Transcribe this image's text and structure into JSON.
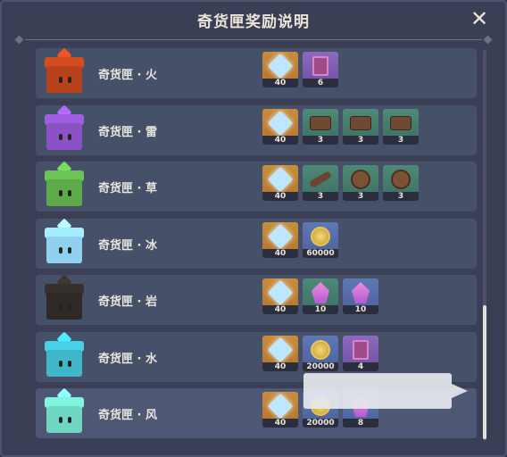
{
  "header": {
    "title": "奇货匣奖励说明",
    "close_icon": "close-icon"
  },
  "colors": {
    "panel_bg": "#3b3f55",
    "row_bg": "#475069",
    "text": "#ece5d8"
  },
  "rows": [
    {
      "name": "奇货匣 · 火",
      "box_color": "#b8421c",
      "rewards": [
        {
          "icon": "primogem-icon",
          "qty": "40",
          "rarity": "orange"
        },
        {
          "icon": "book-icon",
          "qty": "6",
          "rarity": "purple"
        }
      ]
    },
    {
      "name": "奇货匣 · 雷",
      "box_color": "#8a52c4",
      "rewards": [
        {
          "icon": "primogem-icon",
          "qty": "40",
          "rarity": "orange"
        },
        {
          "icon": "scroll-icon",
          "qty": "3",
          "rarity": "green"
        },
        {
          "icon": "scroll-icon",
          "qty": "3",
          "rarity": "green"
        },
        {
          "icon": "scroll-icon",
          "qty": "3",
          "rarity": "green"
        }
      ]
    },
    {
      "name": "奇货匣 · 草",
      "box_color": "#5eaa4a",
      "rewards": [
        {
          "icon": "primogem-icon",
          "qty": "40",
          "rarity": "orange"
        },
        {
          "icon": "branch-icon",
          "qty": "3",
          "rarity": "green"
        },
        {
          "icon": "mask-icon",
          "qty": "3",
          "rarity": "green"
        },
        {
          "icon": "mask-icon",
          "qty": "3",
          "rarity": "green"
        }
      ]
    },
    {
      "name": "奇货匣 · 冰",
      "box_color": "#8fd0ef",
      "rewards": [
        {
          "icon": "primogem-icon",
          "qty": "40",
          "rarity": "orange"
        },
        {
          "icon": "mora-icon",
          "qty": "60000",
          "rarity": "blue"
        }
      ]
    },
    {
      "name": "奇货匣 · 岩",
      "box_color": "#2f2a26",
      "rewards": [
        {
          "icon": "primogem-icon",
          "qty": "40",
          "rarity": "orange"
        },
        {
          "icon": "crystal-icon",
          "qty": "10",
          "rarity": "green"
        },
        {
          "icon": "crystal-icon",
          "qty": "10",
          "rarity": "blue"
        }
      ]
    },
    {
      "name": "奇货匣 · 水",
      "box_color": "#3fb7c9",
      "rewards": [
        {
          "icon": "primogem-icon",
          "qty": "40",
          "rarity": "orange"
        },
        {
          "icon": "mora-icon",
          "qty": "20000",
          "rarity": "blue"
        },
        {
          "icon": "book-icon",
          "qty": "4",
          "rarity": "purple"
        }
      ]
    },
    {
      "name": "奇货匣 · 风",
      "box_color": "#6fd6c4",
      "rewards": [
        {
          "icon": "primogem-icon",
          "qty": "40",
          "rarity": "orange"
        },
        {
          "icon": "mora-icon",
          "qty": "20000",
          "rarity": "blue"
        },
        {
          "icon": "crystal-icon",
          "qty": "8",
          "rarity": "blue"
        }
      ]
    }
  ]
}
